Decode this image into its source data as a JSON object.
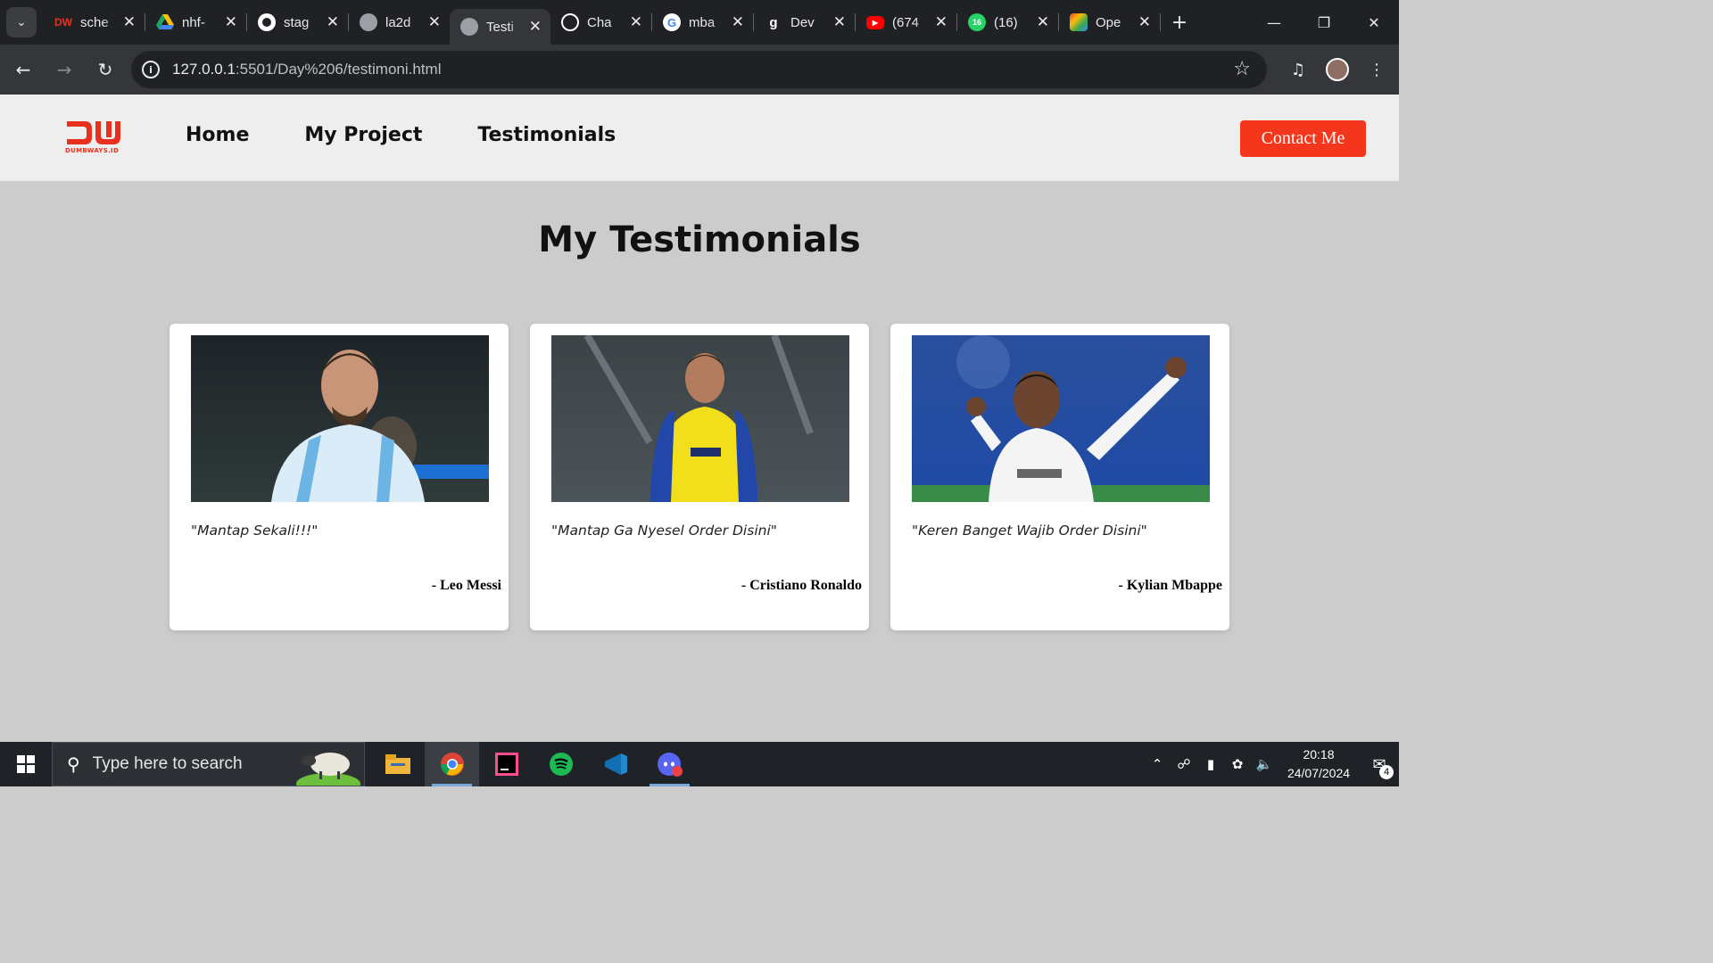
{
  "browser": {
    "tabs": [
      {
        "title": "sche",
        "favicon": "dumbways-icon",
        "color": "#e8301f",
        "active": false
      },
      {
        "title": "nhf-",
        "favicon": "google-drive-icon",
        "color": "#1fa463",
        "active": false
      },
      {
        "title": "stag",
        "favicon": "github-icon",
        "color": "#ffffff",
        "active": false
      },
      {
        "title": "la2d",
        "favicon": "globe-icon",
        "color": "#9aa0a6",
        "active": false
      },
      {
        "title": "Testi",
        "favicon": "globe-icon",
        "color": "#9aa0a6",
        "active": true
      },
      {
        "title": "Cha",
        "favicon": "chatgpt-icon",
        "color": "#ffffff",
        "active": false
      },
      {
        "title": "mba",
        "favicon": "google-icon",
        "color": "#ffffff",
        "active": false
      },
      {
        "title": "Dev",
        "favicon": "g-icon",
        "color": "#ffffff",
        "active": false
      },
      {
        "title": "(674",
        "favicon": "youtube-icon",
        "color": "#ff0000",
        "active": false
      },
      {
        "title": "(16)",
        "favicon": "whatsapp-icon",
        "color": "#25d366",
        "active": false
      },
      {
        "title": "Ope",
        "favicon": "app-icon",
        "color": "#f4b400",
        "active": false
      }
    ],
    "url_host": "127.0.0.1",
    "url_path": ":5501/Day%206/testimoni.html"
  },
  "navbar": {
    "logo_text": "DUMBWAYS.ID",
    "links": [
      "Home",
      "My Project",
      "Testimonials"
    ],
    "contact_label": "Contact Me",
    "accent_color": "#f4361c"
  },
  "page": {
    "heading": "My Testimonials"
  },
  "testimonials": [
    {
      "quote": "\"Mantap Sekali!!!\"",
      "author": "- Leo Messi",
      "photo": "leo-messi-photo"
    },
    {
      "quote": "\"Mantap Ga Nyesel Order Disini\"",
      "author": "- Cristiano Ronaldo",
      "photo": "cristiano-ronaldo-photo"
    },
    {
      "quote": "\"Keren Banget Wajib Order Disini\"",
      "author": "- Kylian Mbappe",
      "photo": "kylian-mbappe-photo"
    }
  ],
  "taskbar": {
    "search_placeholder": "Type here to search",
    "time": "20:18",
    "date": "24/07/2024",
    "notification_count": "4",
    "apps": [
      "file-explorer-icon",
      "chrome-icon",
      "intellij-icon",
      "spotify-icon",
      "vscode-icon",
      "discord-icon"
    ]
  }
}
